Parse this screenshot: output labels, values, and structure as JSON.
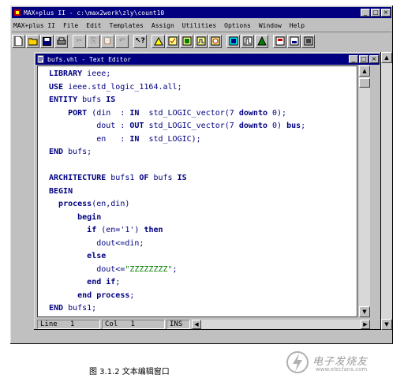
{
  "app": {
    "title": "MAX+plus II - c:\\max2work\\zly\\count10",
    "menu": [
      "MAX+plus II",
      "File",
      "Edit",
      "Templates",
      "Assign",
      "Utilities",
      "Options",
      "Window",
      "Help"
    ],
    "toolbar_icons": [
      "new-file",
      "open-file",
      "save",
      "print",
      "cut",
      "copy",
      "paste",
      "undo",
      "help-pointer",
      "hierarchy",
      "project-save-check",
      "project-save-compile",
      "project-save-simulate",
      "timing-analyzer",
      "compiler",
      "simulator",
      "waveform-editor",
      "floorplan-editor"
    ]
  },
  "editor": {
    "title": "bufs.vhl - Text Editor",
    "code_lines": [
      "LIBRARY ieee;",
      "USE ieee.std_logic_1164.all;",
      "ENTITY bufs IS",
      "    PORT (din  : IN  std_LOGIC_vector(7 downto 0);",
      "          dout : OUT std_LOGIC_vector(7 downto 0) bus;",
      "          en   : IN  std_LOGIC);",
      "END bufs;",
      "",
      "ARCHITECTURE bufs1 OF bufs IS",
      "BEGIN",
      "  process(en,din)",
      "      begin",
      "        if (en='1') then",
      "          dout<=din;",
      "        else",
      "          dout<=\"ZZZZZZZZ\";",
      "        end if;",
      "      end process;",
      "END bufs1;"
    ]
  },
  "status": {
    "line_label": "Line",
    "line_value": "1",
    "col_label": "Col",
    "col_value": "1",
    "mode": "INS"
  },
  "caption": "图 3.1.2  文本编辑窗口",
  "watermark": {
    "text": "电子发烧友",
    "url": "www.elecfans.com"
  }
}
